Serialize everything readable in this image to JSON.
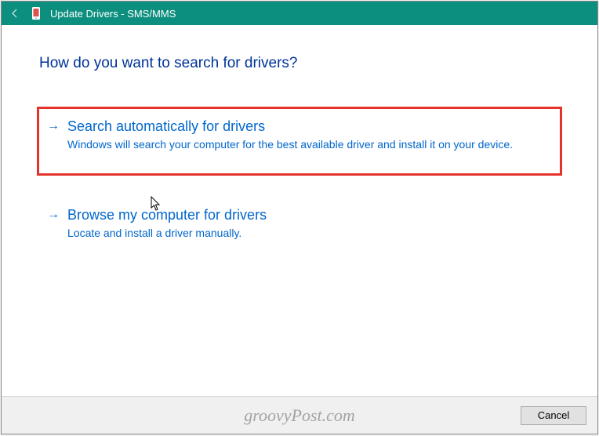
{
  "titlebar": {
    "title": "Update Drivers - SMS/MMS"
  },
  "heading": "How do you want to search for drivers?",
  "options": [
    {
      "title": "Search automatically for drivers",
      "description": "Windows will search your computer for the best available driver and install it on your device."
    },
    {
      "title": "Browse my computer for drivers",
      "description": "Locate and install a driver manually."
    }
  ],
  "footer": {
    "cancel_label": "Cancel"
  },
  "watermark": "groovyPost.com"
}
